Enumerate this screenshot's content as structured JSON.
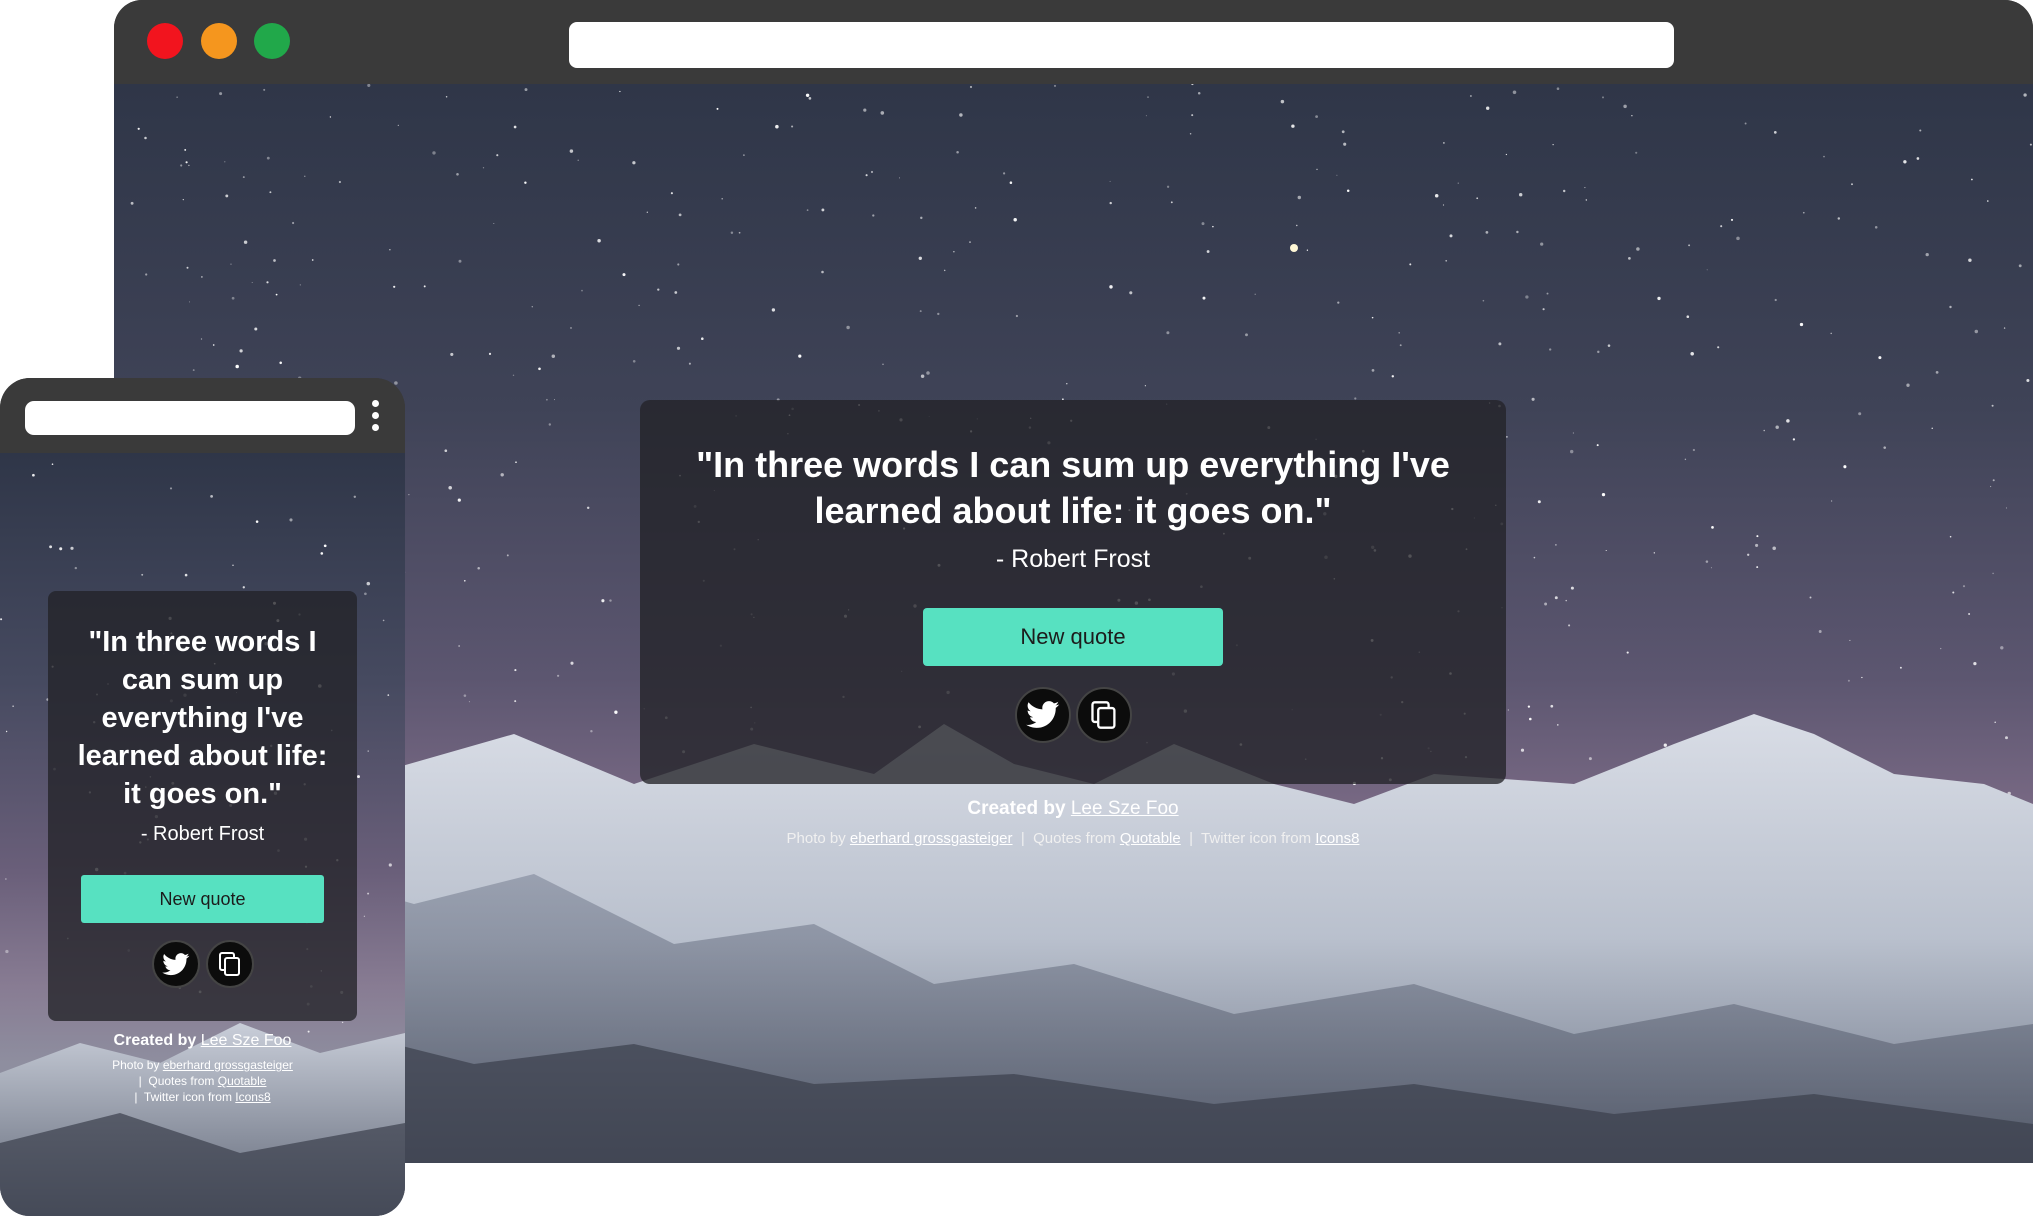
{
  "desktop": {
    "quote": "\"In three words I can sum up everything I've learned about life: it goes on.\"",
    "author": "- Robert Frost",
    "new_quote_label": "New quote",
    "twitter_icon": "twitter-icon",
    "copy_icon": "copy-icon",
    "created_by_prefix": "Created by",
    "created_by_name": "Lee Sze Foo",
    "photo_prefix": "Photo by",
    "photo_name": "eberhard grossgasteiger",
    "separator": "|",
    "quotes_prefix": "Quotes from",
    "quotes_name": "Quotable",
    "twitter_icon_prefix": "Twitter icon from",
    "twitter_icon_name": "Icons8"
  },
  "mobile": {
    "quote": "\"In three words I can sum up everything I've learned about life: it goes on.\"",
    "author": "- Robert Frost",
    "new_quote_label": "New quote",
    "created_by_prefix": "Created by",
    "created_by_name": "Lee Sze Foo",
    "photo_prefix": "Photo by",
    "photo_name": "eberhard grossgasteiger",
    "separator": "|",
    "quotes_prefix": "Quotes from",
    "quotes_name": "Quotable",
    "twitter_icon_prefix": "Twitter icon from",
    "twitter_icon_name": "Icons8"
  },
  "colors": {
    "accent": "#57e1c1",
    "traffic_red": "#f2141e",
    "traffic_yellow": "#f5961e",
    "traffic_green": "#21a84a",
    "card_bg": "#232328",
    "chrome": "#3a3a3a"
  }
}
